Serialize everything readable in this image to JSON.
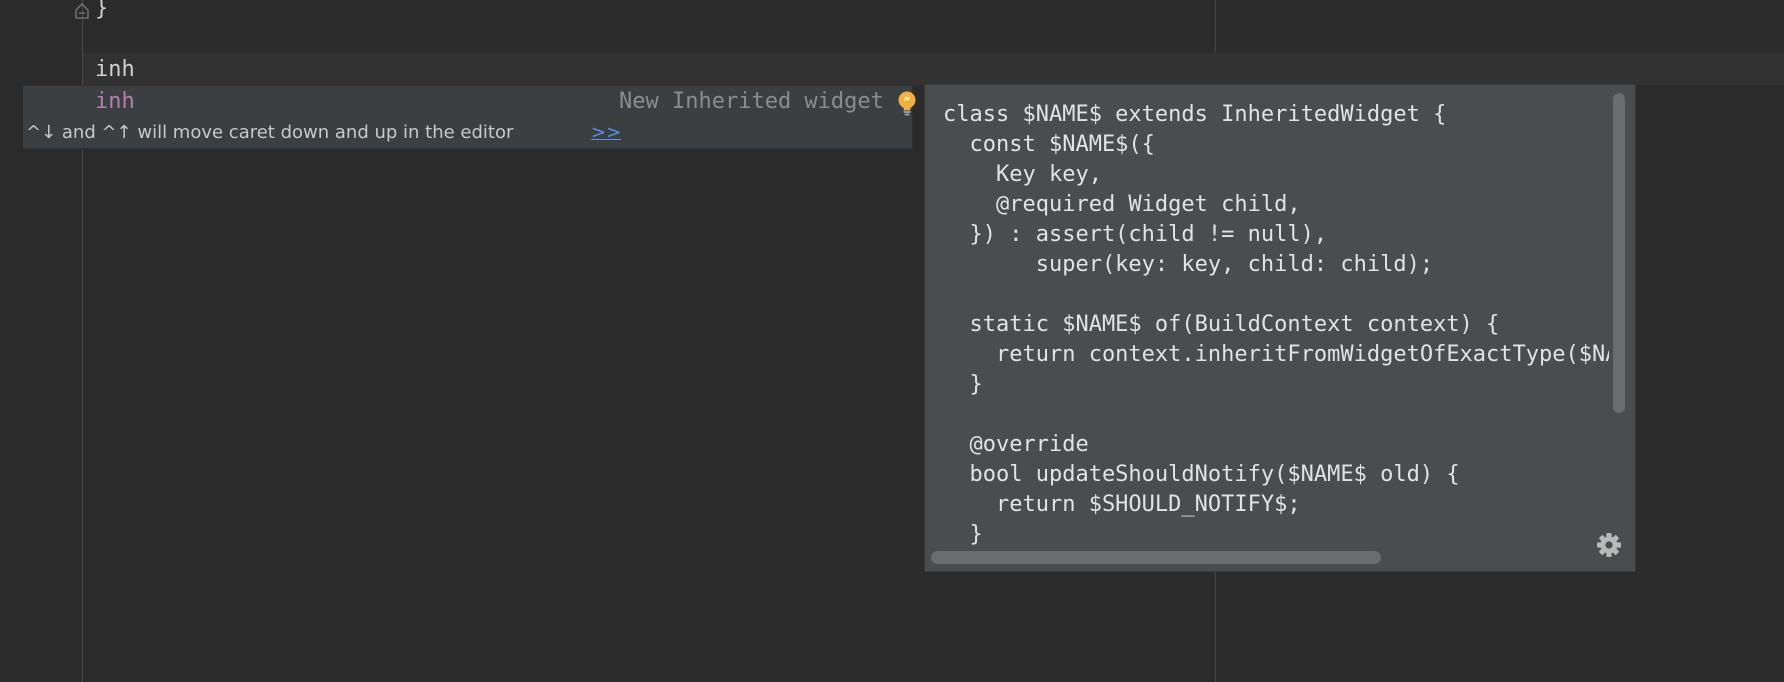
{
  "editor": {
    "brace_line": "}",
    "typed_line": "inh"
  },
  "completion": {
    "abbreviation": "inh",
    "description": "New Inherited widget",
    "hint_text": "^↓ and ^↑ will move caret down and up in the editor",
    "hint_link": ">>",
    "icons": [
      "fold-icon",
      "bulb-icon"
    ]
  },
  "documentation": {
    "code": "class $NAME$ extends InheritedWidget {\n  const $NAME$({\n    Key key,\n    @required Widget child,\n  }) : assert(child != null),\n       super(key: key, child: child);\n\n  static $NAME$ of(BuildContext context) {\n    return context.inheritFromWidgetOfExactType($NAME$) as $NAME$;\n  }\n\n  @override\n  bool updateShouldNotify($NAME$ old) {\n    return $SHOULD_NOTIFY$;\n  }\n}",
    "icons": [
      "gear-icon"
    ]
  },
  "colors": {
    "editor_bg": "#2b2b2b",
    "popup_bg": "#3c3f41",
    "doc_bg": "#4a4c4e",
    "template_abbr": "#b080b0",
    "link": "#5394ec",
    "bulb": "#f0b040"
  }
}
